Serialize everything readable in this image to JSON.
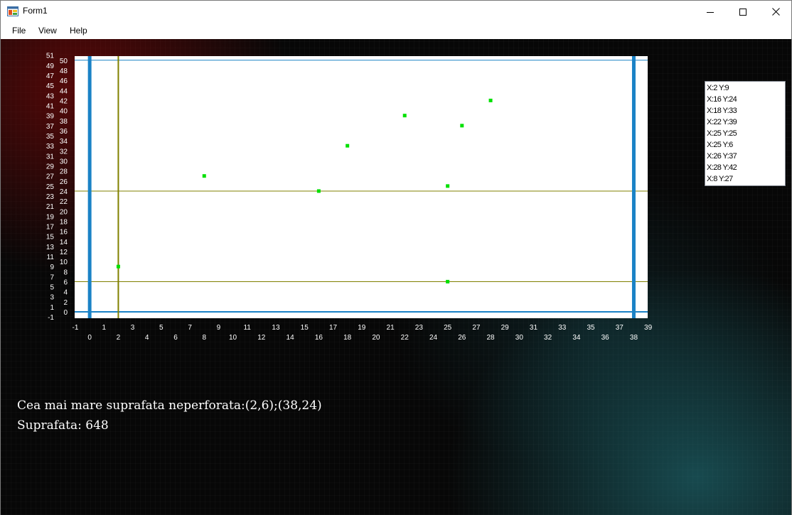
{
  "window": {
    "title": "Form1",
    "controls": [
      "minimize-icon",
      "maximize-icon",
      "close-icon"
    ]
  },
  "menu": {
    "file": "File",
    "view": "View",
    "help": "Help"
  },
  "chart_data": {
    "type": "scatter",
    "xlim": [
      -1,
      39
    ],
    "ylim": [
      -1,
      51
    ],
    "x_ticks": [
      -1,
      0,
      1,
      2,
      3,
      4,
      5,
      6,
      7,
      8,
      9,
      10,
      11,
      12,
      13,
      14,
      15,
      16,
      17,
      18,
      19,
      20,
      21,
      22,
      23,
      24,
      25,
      26,
      27,
      28,
      29,
      30,
      31,
      32,
      33,
      34,
      35,
      36,
      37,
      38,
      39
    ],
    "y_ticks": [
      -1,
      0,
      1,
      2,
      3,
      4,
      5,
      6,
      7,
      8,
      9,
      10,
      11,
      12,
      13,
      14,
      15,
      16,
      17,
      18,
      19,
      20,
      21,
      22,
      23,
      24,
      25,
      26,
      27,
      28,
      29,
      30,
      31,
      32,
      33,
      34,
      35,
      36,
      37,
      38,
      39,
      40,
      41,
      42,
      43,
      44,
      45,
      46,
      47,
      48,
      49,
      50,
      51
    ],
    "points": [
      {
        "x": 2,
        "y": 9
      },
      {
        "x": 16,
        "y": 24
      },
      {
        "x": 18,
        "y": 33
      },
      {
        "x": 22,
        "y": 39
      },
      {
        "x": 25,
        "y": 25
      },
      {
        "x": 25,
        "y": 6
      },
      {
        "x": 26,
        "y": 37
      },
      {
        "x": 28,
        "y": 42
      },
      {
        "x": 8,
        "y": 27
      }
    ],
    "boundary_vertical": [
      0,
      38
    ],
    "boundary_horizontal": [
      0,
      50
    ],
    "highlight_vertical": [
      2
    ],
    "highlight_horizontal": [
      6,
      24
    ],
    "colors": {
      "plot_background": "#ffffff",
      "point": "#00e000",
      "boundary": "#1a82c6",
      "highlight": "#808000",
      "tick_label": "#ffffff"
    }
  },
  "coordinates_list": [
    "X:2 Y:9",
    "X:16 Y:24",
    "X:18 Y:33",
    "X:22 Y:39",
    "X:25 Y:25",
    "X:25 Y:6",
    "X:26 Y:37",
    "X:28 Y:42",
    "X:8 Y:27"
  ],
  "result": {
    "line1": "Cea mai mare suprafata neperforata:(2,6);(38,24)",
    "line2": "Suprafata: 648"
  }
}
